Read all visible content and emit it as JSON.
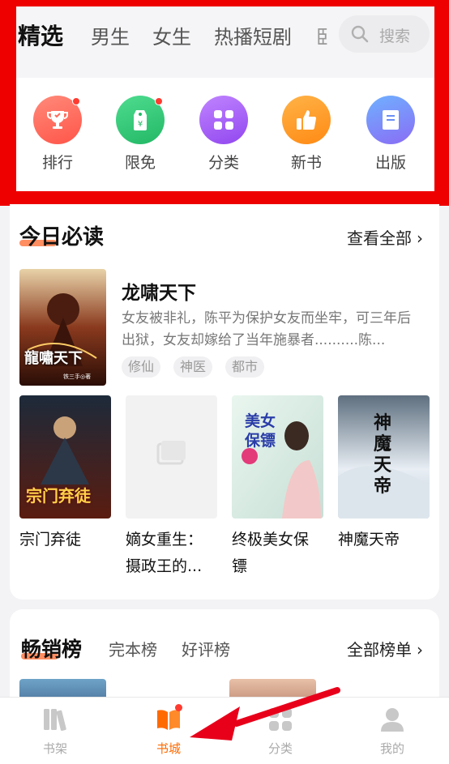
{
  "header": {
    "tabs": [
      "精选",
      "男生",
      "女生",
      "热播短剧"
    ],
    "clipped_tab": "卧",
    "search_placeholder": "搜索"
  },
  "quick_entries": [
    {
      "label": "排行",
      "icon": "trophy-icon",
      "color": "#ff6b5b",
      "dot": true
    },
    {
      "label": "限免",
      "icon": "price-tag-icon",
      "color": "#33c77a",
      "dot": true
    },
    {
      "label": "分类",
      "icon": "grid-icon",
      "color": "#a35cf5",
      "dot": false
    },
    {
      "label": "新书",
      "icon": "thumbs-up-icon",
      "color": "#ff9a28",
      "dot": false
    },
    {
      "label": "出版",
      "icon": "book-icon",
      "color": "#4f8ef7",
      "dot": false
    }
  ],
  "daily": {
    "title": "今日必读",
    "see_all": "查看全部",
    "featured": {
      "title": "龙啸天下",
      "description": "女友被非礼，陈平为保护女友而坐牢，可三年后出狱，女友却嫁给了当年施暴者..........陈...",
      "tags": [
        "修仙",
        "神医",
        "都市"
      ],
      "cover_text": "龍嘯天下",
      "cover_author": "铁三手◎著"
    },
    "books": [
      {
        "title_line1": "宗门弃徒",
        "title_line2": "",
        "cover_text": "宗门弃徒"
      },
      {
        "title_line1": "嫡女重生：",
        "title_line2": "摄政王的...",
        "cover_text": ""
      },
      {
        "title_line1": "终极美女保",
        "title_line2": "镖",
        "cover_text": "美女保镖"
      },
      {
        "title_line1": "神魔天帝",
        "title_line2": "",
        "cover_text": "神魔天帝"
      }
    ]
  },
  "ranking": {
    "tabs": [
      "畅销榜",
      "完本榜",
      "好评榜"
    ],
    "see_all": "全部榜单"
  },
  "bottom_nav": [
    {
      "label": "书架",
      "icon": "bookshelf-icon",
      "active": false
    },
    {
      "label": "书城",
      "icon": "bookstore-icon",
      "active": true
    },
    {
      "label": "分类",
      "icon": "category-icon",
      "active": false
    },
    {
      "label": "我的",
      "icon": "profile-icon",
      "active": false
    }
  ],
  "colors": {
    "highlight_box": "#ee0000",
    "accent": "#ff6a00",
    "annotation_arrow": "#e8001a"
  }
}
